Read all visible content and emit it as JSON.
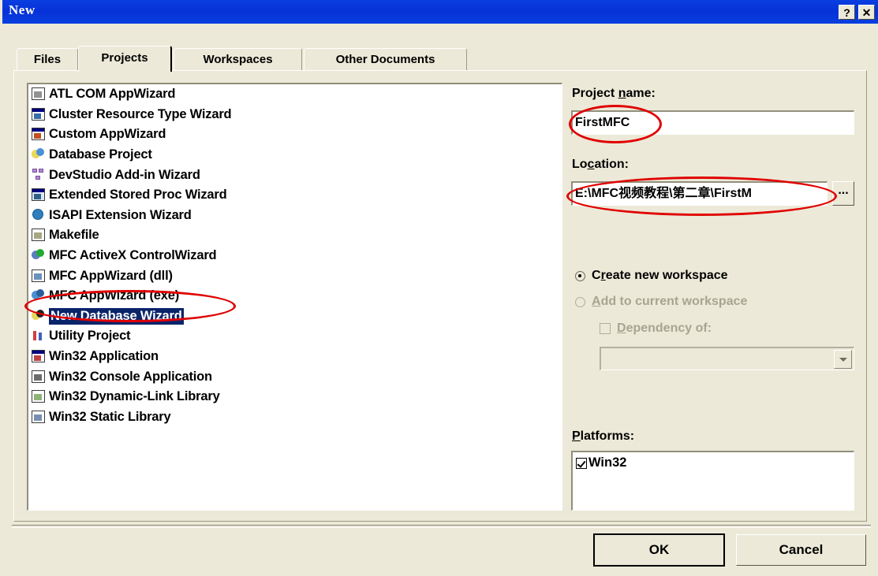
{
  "window": {
    "title": "New",
    "help_button": "?",
    "close_button": "✕"
  },
  "tabs": [
    {
      "label": "Files",
      "selected": false
    },
    {
      "label": "Projects",
      "selected": true
    },
    {
      "label": "Workspaces",
      "selected": false
    },
    {
      "label": "Other Documents",
      "selected": false
    }
  ],
  "project_list": {
    "selected_index": 11,
    "items": [
      {
        "label": "ATL COM AppWizard",
        "icon": "atl-com-appwizard-icon"
      },
      {
        "label": "Cluster Resource Type Wizard",
        "icon": "cluster-resource-type-wizard-icon"
      },
      {
        "label": "Custom AppWizard",
        "icon": "custom-appwizard-icon"
      },
      {
        "label": "Database Project",
        "icon": "database-project-icon"
      },
      {
        "label": "DevStudio Add-in Wizard",
        "icon": "devstudio-addin-wizard-icon"
      },
      {
        "label": "Extended Stored Proc Wizard",
        "icon": "extended-stored-proc-wizard-icon"
      },
      {
        "label": "ISAPI Extension Wizard",
        "icon": "isapi-extension-wizard-icon"
      },
      {
        "label": "Makefile",
        "icon": "makefile-icon"
      },
      {
        "label": "MFC ActiveX ControlWizard",
        "icon": "mfc-activex-controlwizard-icon"
      },
      {
        "label": "MFC AppWizard (dll)",
        "icon": "mfc-appwizard-dll-icon"
      },
      {
        "label": "MFC AppWizard (exe)",
        "icon": "mfc-appwizard-exe-icon"
      },
      {
        "label": "New Database Wizard",
        "icon": "new-database-wizard-icon"
      },
      {
        "label": "Utility Project",
        "icon": "utility-project-icon"
      },
      {
        "label": "Win32 Application",
        "icon": "win32-application-icon"
      },
      {
        "label": "Win32 Console Application",
        "icon": "win32-console-application-icon"
      },
      {
        "label": "Win32 Dynamic-Link Library",
        "icon": "win32-dynamic-link-library-icon"
      },
      {
        "label": "Win32 Static Library",
        "icon": "win32-static-library-icon"
      }
    ]
  },
  "project_name": {
    "label_pre": "Project ",
    "label_accel": "n",
    "label_post": "ame:",
    "value": "FirstMFC",
    "placeholder": ""
  },
  "location": {
    "label_pre": "Lo",
    "label_accel": "c",
    "label_post": "ation:",
    "value": "E:\\MFC视频教程\\第二章\\FirstM",
    "placeholder": "",
    "browse_label": "..."
  },
  "workspace_options": {
    "create_new": {
      "text_pre": "C",
      "text_accel": "r",
      "text_post": "eate new workspace",
      "selected": true,
      "enabled": true
    },
    "add_current": {
      "text_pre": "",
      "text_accel": "A",
      "text_post": "dd to current workspace",
      "selected": false,
      "enabled": false
    },
    "dependency": {
      "text_pre": "",
      "text_accel": "D",
      "text_post": "ependency of:",
      "checked": false,
      "enabled": false
    },
    "dependency_combo_value": ""
  },
  "platforms": {
    "label_pre": "",
    "label_accel": "P",
    "label_post": "latforms:",
    "items": [
      {
        "label": "Win32",
        "checked": true
      }
    ]
  },
  "footer": {
    "ok_label": "OK",
    "cancel_label": "Cancel"
  },
  "colors": {
    "titlebar": "#0836dc",
    "dialog_face": "#ece9d8",
    "selection": "#0a246a",
    "annotation": "#e00000",
    "field_bg": "#ffffff",
    "disabled_text": "#a7a592"
  }
}
